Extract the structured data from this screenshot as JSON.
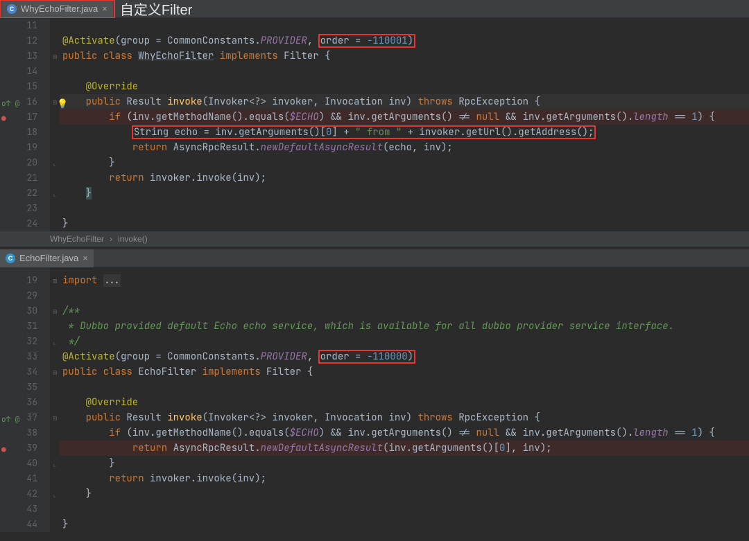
{
  "pane1": {
    "tab": {
      "filename": "WhyEchoFilter.java",
      "icon_letter": "C"
    },
    "annotation": "自定义Filter",
    "breadcrumb": {
      "class": "WhyEchoFilter",
      "method": "invoke()"
    },
    "lines": {
      "start": 11,
      "rows": [
        {
          "n": 11,
          "code": ""
        },
        {
          "n": 12,
          "code": "@Activate(group = CommonConstants.PROVIDER, order = -110001)"
        },
        {
          "n": 13,
          "code": "public class WhyEchoFilter implements Filter {"
        },
        {
          "n": 14,
          "code": ""
        },
        {
          "n": 15,
          "code": "    @Override"
        },
        {
          "n": 16,
          "code": "    public Result invoke(Invoker<?> invoker, Invocation inv) throws RpcException {"
        },
        {
          "n": 17,
          "code": "        if (inv.getMethodName().equals($ECHO) && inv.getArguments() != null && inv.getArguments().length == 1) {"
        },
        {
          "n": 18,
          "code": "            String echo = inv.getArguments()[0] + \" from \" + invoker.getUrl().getAddress();"
        },
        {
          "n": 19,
          "code": "            return AsyncRpcResult.newDefaultAsyncResult(echo, inv);"
        },
        {
          "n": 20,
          "code": "        }"
        },
        {
          "n": 21,
          "code": "        return invoker.invoke(inv);"
        },
        {
          "n": 22,
          "code": "    }"
        },
        {
          "n": 23,
          "code": ""
        },
        {
          "n": 24,
          "code": "}"
        }
      ]
    }
  },
  "pane2": {
    "tab": {
      "filename": "EchoFilter.java",
      "icon_letter": "C"
    },
    "lines": {
      "rows": [
        {
          "n": "",
          "gap": true
        },
        {
          "n": 19,
          "code": "import ..."
        },
        {
          "n": 29,
          "code": ""
        },
        {
          "n": 30,
          "code": "/**"
        },
        {
          "n": 31,
          "code": " * Dubbo provided default Echo echo service, which is available for all dubbo provider service interface."
        },
        {
          "n": 32,
          "code": " */"
        },
        {
          "n": 33,
          "code": "@Activate(group = CommonConstants.PROVIDER, order = -110000)"
        },
        {
          "n": 34,
          "code": "public class EchoFilter implements Filter {"
        },
        {
          "n": 35,
          "code": ""
        },
        {
          "n": 36,
          "code": "    @Override"
        },
        {
          "n": 37,
          "code": "    public Result invoke(Invoker<?> invoker, Invocation inv) throws RpcException {"
        },
        {
          "n": 38,
          "code": "        if (inv.getMethodName().equals($ECHO) && inv.getArguments() != null && inv.getArguments().length == 1) {"
        },
        {
          "n": 39,
          "code": "            return AsyncRpcResult.newDefaultAsyncResult(inv.getArguments()[0], inv);"
        },
        {
          "n": 40,
          "code": "        }"
        },
        {
          "n": 41,
          "code": "        return invoker.invoke(inv);"
        },
        {
          "n": 42,
          "code": "    }"
        },
        {
          "n": 43,
          "code": ""
        },
        {
          "n": 44,
          "code": "}"
        }
      ]
    }
  }
}
